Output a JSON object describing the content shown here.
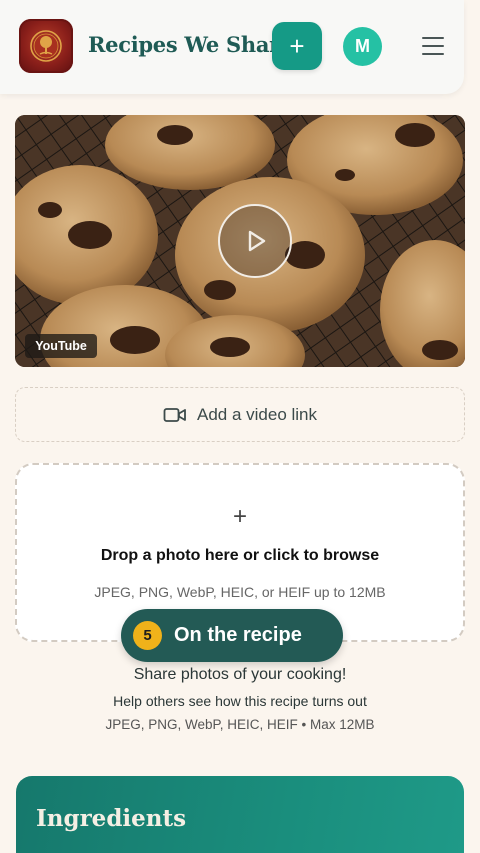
{
  "header": {
    "brand": "Recipes We Share",
    "add_label": "+",
    "avatar_initial": "M",
    "icons": {
      "logo": "tree-emblem-icon",
      "menu": "hamburger-icon"
    }
  },
  "video": {
    "badge": "YouTube",
    "icon": "play-icon"
  },
  "video_link": {
    "label": "Add a video link",
    "icon": "video-camera-icon"
  },
  "dropzone": {
    "plus": "+",
    "title": "Drop a photo here or click to browse",
    "subtitle": "JPEG, PNG, WebP, HEIC, or HEIF up to 12MB"
  },
  "step": {
    "number": "5",
    "label": "On the recipe"
  },
  "help": {
    "line1": "Share photos of your cooking!",
    "line2": "Help others see how this recipe turns out",
    "line3": "JPEG, PNG, WebP, HEIC, HEIF • Max 12MB"
  },
  "ingredients": {
    "title": "Ingredients"
  },
  "colors": {
    "background": "#fbf5ee",
    "brand_text": "#1f5b55",
    "accent": "#159a86",
    "avatar": "#25c1a4",
    "pill": "#235a55",
    "step_badge": "#f0b21a"
  }
}
